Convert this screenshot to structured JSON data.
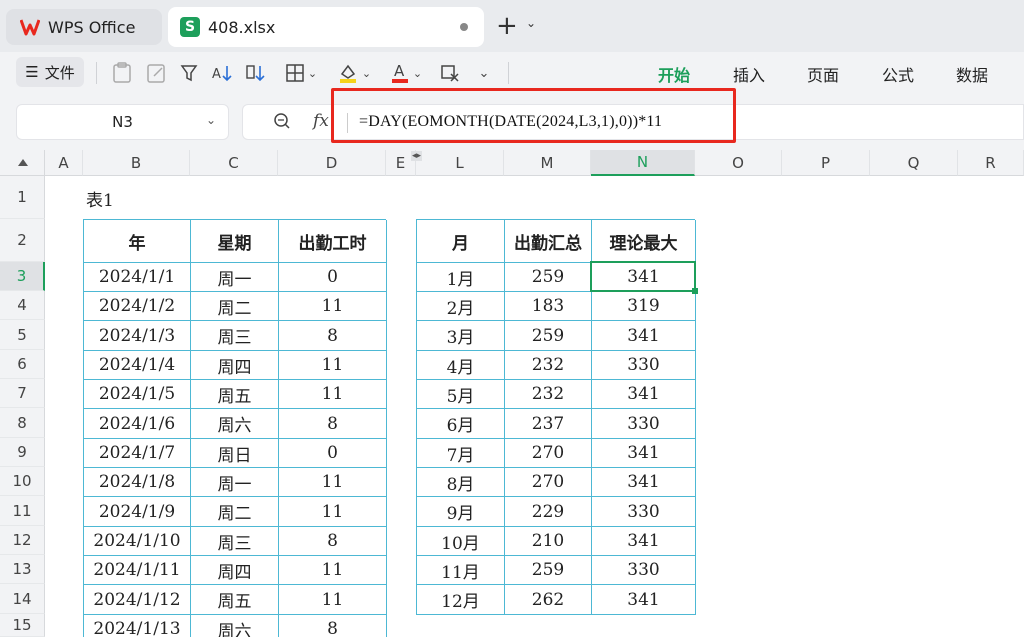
{
  "tabs": {
    "app_label": "WPS Office",
    "file_label": "408.xlsx"
  },
  "ribbon": {
    "menu_label": "文件",
    "tabs": [
      "开始",
      "插入",
      "页面",
      "公式",
      "数据"
    ],
    "active_tab": "开始"
  },
  "formula_bar": {
    "cell_ref": "N3",
    "formula": "=DAY(EOMONTH(DATE(2024,L3,1),0))*11"
  },
  "columns": [
    "A",
    "B",
    "C",
    "D",
    "E",
    "L",
    "M",
    "N",
    "O",
    "P",
    "Q",
    "R"
  ],
  "rows": [
    "1",
    "2",
    "3",
    "4",
    "5",
    "6",
    "7",
    "8",
    "9",
    "10",
    "11",
    "12",
    "13",
    "14",
    "15"
  ],
  "table1": {
    "label": "表1",
    "headers": [
      "年",
      "星期",
      "出勤工时"
    ],
    "rows": [
      [
        "2024/1/1",
        "周一",
        "0"
      ],
      [
        "2024/1/2",
        "周二",
        "11"
      ],
      [
        "2024/1/3",
        "周三",
        "8"
      ],
      [
        "2024/1/4",
        "周四",
        "11"
      ],
      [
        "2024/1/5",
        "周五",
        "11"
      ],
      [
        "2024/1/6",
        "周六",
        "8"
      ],
      [
        "2024/1/7",
        "周日",
        "0"
      ],
      [
        "2024/1/8",
        "周一",
        "11"
      ],
      [
        "2024/1/9",
        "周二",
        "11"
      ],
      [
        "2024/1/10",
        "周三",
        "8"
      ],
      [
        "2024/1/11",
        "周四",
        "11"
      ],
      [
        "2024/1/12",
        "周五",
        "11"
      ],
      [
        "2024/1/13",
        "周六",
        "8"
      ]
    ]
  },
  "table2": {
    "headers": [
      "月",
      "出勤汇总",
      "理论最大"
    ],
    "rows": [
      [
        "1月",
        "259",
        "341"
      ],
      [
        "2月",
        "183",
        "319"
      ],
      [
        "3月",
        "259",
        "341"
      ],
      [
        "4月",
        "232",
        "330"
      ],
      [
        "5月",
        "232",
        "341"
      ],
      [
        "6月",
        "237",
        "330"
      ],
      [
        "7月",
        "270",
        "341"
      ],
      [
        "8月",
        "270",
        "341"
      ],
      [
        "9月",
        "229",
        "330"
      ],
      [
        "10月",
        "210",
        "341"
      ],
      [
        "11月",
        "259",
        "330"
      ],
      [
        "12月",
        "262",
        "341"
      ]
    ]
  },
  "colors": {
    "accent": "#1d9f5b",
    "table_border": "#4db8d4",
    "highlight_box": "#e8281e"
  }
}
